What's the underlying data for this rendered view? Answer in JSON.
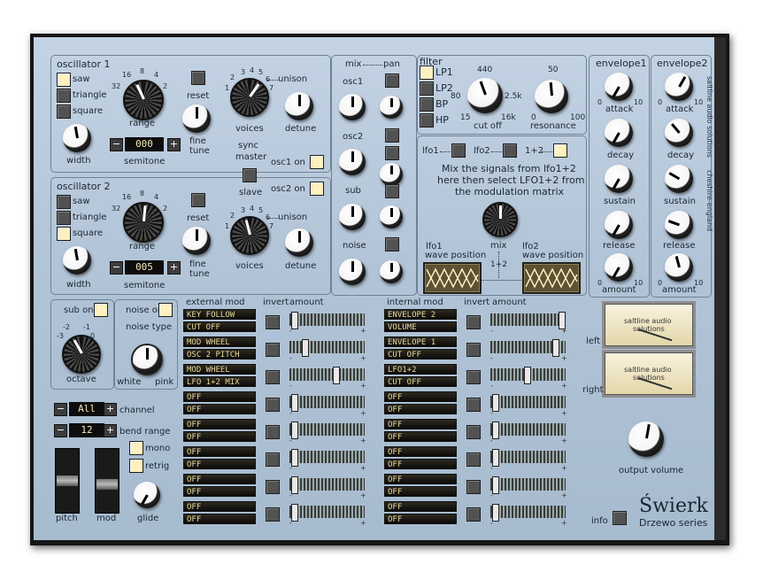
{
  "osc1": {
    "title": "oscillator 1",
    "waves": [
      "saw",
      "triangle",
      "square"
    ],
    "width": "width",
    "range": "range",
    "range_ticks": [
      "32",
      "16",
      "8",
      "4",
      "2"
    ],
    "semitone": "semitone",
    "semitone_value": "000",
    "reset": "reset",
    "fine": "fine",
    "tune": "tune",
    "voices": "voices",
    "voice_ticks": [
      "1",
      "2",
      "3",
      "4",
      "5",
      "6",
      "7"
    ],
    "unison": "unison",
    "detune": "detune",
    "on": "osc1 on"
  },
  "sync": {
    "sync": "sync",
    "master": "master",
    "slave": "slave"
  },
  "osc2": {
    "title": "oscillator 2",
    "waves": [
      "saw",
      "triangle",
      "square"
    ],
    "width": "width",
    "range": "range",
    "range_ticks": [
      "32",
      "16",
      "8",
      "4",
      "2"
    ],
    "semitone": "semitone",
    "semitone_value": "005",
    "reset": "reset",
    "fine": "fine",
    "tune": "tune",
    "voices": "voices",
    "voice_ticks": [
      "1",
      "2",
      "3",
      "4",
      "5",
      "6",
      "7"
    ],
    "unison": "unison",
    "detune": "detune",
    "on": "osc2 on"
  },
  "mixer": {
    "mix": "mix",
    "pan": "pan",
    "rows": [
      "osc1",
      "osc2",
      "sub",
      "noise"
    ]
  },
  "filter": {
    "title": "filter",
    "types": [
      "LP1",
      "LP2",
      "BP",
      "HP"
    ],
    "cutoff": "cut off",
    "cutoff_ticks": [
      "440",
      "80",
      "2.5k",
      "15",
      "16k"
    ],
    "resonance": "resonance",
    "res_ticks": [
      "50",
      "0",
      "100"
    ]
  },
  "lfo": {
    "lfo1": "lfo1",
    "lfo2": "lfo2",
    "lfo12": "1+2",
    "text": [
      "Mix the signals from lfo1+2",
      "here then select LFO1+2 from",
      "the modulation matrix"
    ],
    "mix": "mix",
    "wave_position": "wave position"
  },
  "env1": {
    "title": "envelope1",
    "attack": "attack",
    "decay": "decay",
    "sustain": "sustain",
    "release": "release",
    "amount": "amount"
  },
  "env2": {
    "title": "envelope2",
    "attack": "attack",
    "decay": "decay",
    "sustain": "sustain",
    "release": "release",
    "amount": "amount"
  },
  "env_scale": {
    "min": "0",
    "max": "10"
  },
  "brand": {
    "line1": "saltline audio solutions",
    "line2": "cheshire-england"
  },
  "sub": {
    "on": "sub on",
    "octave": "octave",
    "ticks": [
      "-3",
      "-2",
      "-1",
      "0"
    ]
  },
  "noise": {
    "on": "noise on",
    "type": "noise type",
    "white": "white",
    "pink": "pink"
  },
  "matrix": {
    "external_header": "external mod",
    "internal_header": "internal mod",
    "invert": "invert",
    "amount": "amount",
    "external": [
      {
        "src": "KEY FOLLOW",
        "dst": "CUT OFF",
        "amount": 0.02
      },
      {
        "src": "MOD WHEEL",
        "dst": "OSC 2 PITCH",
        "amount": 0.18
      },
      {
        "src": "MOD WHEEL",
        "dst": "LFO 1+2 MIX",
        "amount": 0.62
      },
      {
        "src": "OFF",
        "dst": "OFF",
        "amount": 0.02
      },
      {
        "src": "OFF",
        "dst": "OFF",
        "amount": 0.02
      },
      {
        "src": "OFF",
        "dst": "OFF",
        "amount": 0.02
      },
      {
        "src": "OFF",
        "dst": "OFF",
        "amount": 0.02
      },
      {
        "src": "OFF",
        "dst": "OFF",
        "amount": 0.02
      }
    ],
    "internal": [
      {
        "src": "ENVELOPE 2",
        "dst": "VOLUME",
        "amount": 0.98
      },
      {
        "src": "ENVELOPE 1",
        "dst": "CUT OFF",
        "amount": 0.88
      },
      {
        "src": "LFO1+2",
        "dst": "CUT OFF",
        "amount": 0.48
      },
      {
        "src": "OFF",
        "dst": "OFF",
        "amount": 0.02
      },
      {
        "src": "OFF",
        "dst": "OFF",
        "amount": 0.02
      },
      {
        "src": "OFF",
        "dst": "OFF",
        "amount": 0.02
      },
      {
        "src": "OFF",
        "dst": "OFF",
        "amount": 0.02
      },
      {
        "src": "OFF",
        "dst": "OFF",
        "amount": 0.02
      }
    ]
  },
  "controls": {
    "channel_value": "All",
    "channel": "channel",
    "bend_value": "12",
    "bend_range": "bend range",
    "mono": "mono",
    "retrig": "retrig",
    "pitch": "pitch",
    "mod": "mod",
    "glide": "glide"
  },
  "meters": {
    "brand_line1": "saltline audio",
    "brand_line2": "solutions",
    "left": "left",
    "right": "right"
  },
  "output": {
    "label": "output volume"
  },
  "title": {
    "name": "Świerk",
    "series": "Drzewo series",
    "info": "info"
  }
}
